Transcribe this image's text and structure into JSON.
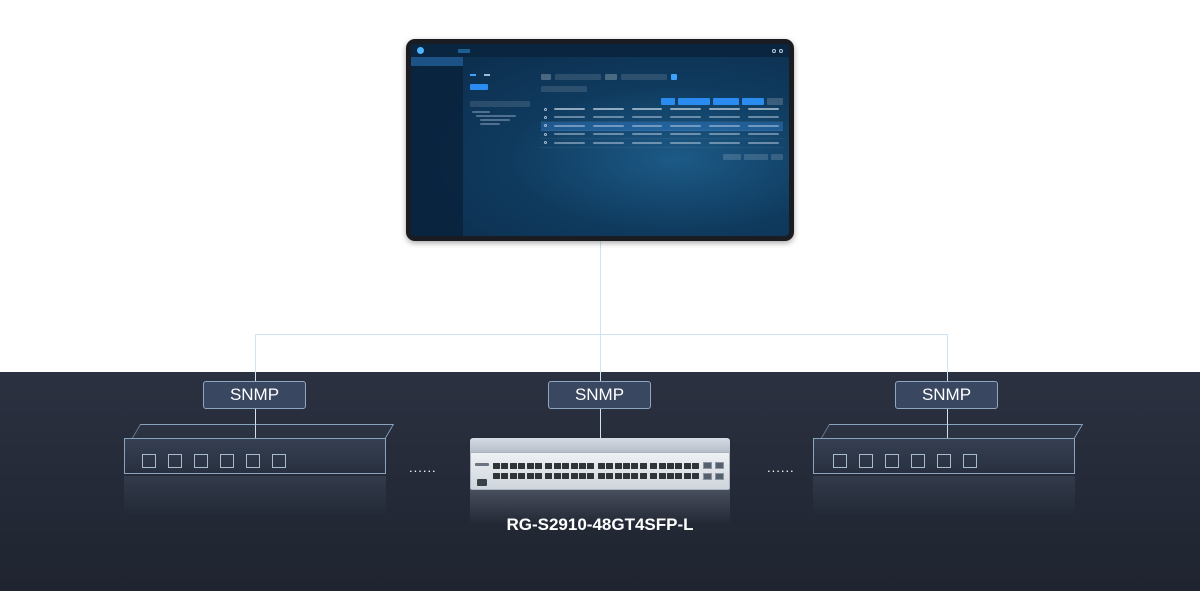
{
  "protocol_label": "SNMP",
  "ellipsis": "......",
  "device_model": "RG-S2910-48GT4SFP-L",
  "colors": {
    "band": "#272d3a",
    "label_fill": "#3a4760",
    "label_border": "#8fa6c2",
    "connector": "#cfe3f3",
    "screen_accent": "#2a8cf0"
  },
  "icons": [
    "monitor-icon",
    "switch-icon"
  ]
}
